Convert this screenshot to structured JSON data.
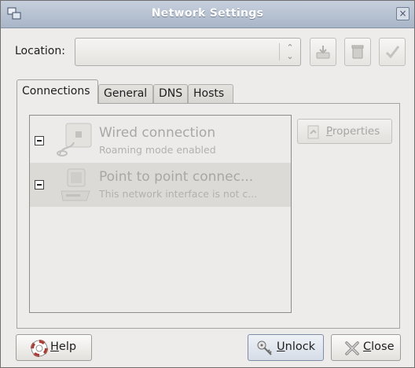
{
  "window": {
    "title": "Network Settings",
    "close_symbol": "×"
  },
  "location": {
    "label": "Location:",
    "value": "",
    "arrow": "⌃⌄"
  },
  "tabs": [
    {
      "label": "Connections",
      "active": true
    },
    {
      "label": "General",
      "active": false
    },
    {
      "label": "DNS",
      "active": false
    },
    {
      "label": "Hosts",
      "active": false
    }
  ],
  "connections": [
    {
      "name": "Wired connection",
      "status": "Roaming mode enabled",
      "icon": "wired-network-icon",
      "selected": false
    },
    {
      "name": "Point to point connec...",
      "status": "This network interface is not c...",
      "icon": "telephone-modem-icon",
      "selected": true
    }
  ],
  "buttons": {
    "properties": {
      "mnemonic": "P",
      "rest": "roperties"
    },
    "help": {
      "mnemonic": "H",
      "rest": "elp"
    },
    "unlock": {
      "mnemonic": "U",
      "rest": "nlock"
    },
    "close": {
      "mnemonic": "C",
      "rest": "lose"
    }
  },
  "icons": [
    "window-icon",
    "close-icon",
    "combo-arrows-icon",
    "save-location-icon",
    "delete-location-icon",
    "apply-icon",
    "properties-icon",
    "lifebuoy-help-icon",
    "keys-icon",
    "close-x-icon"
  ]
}
